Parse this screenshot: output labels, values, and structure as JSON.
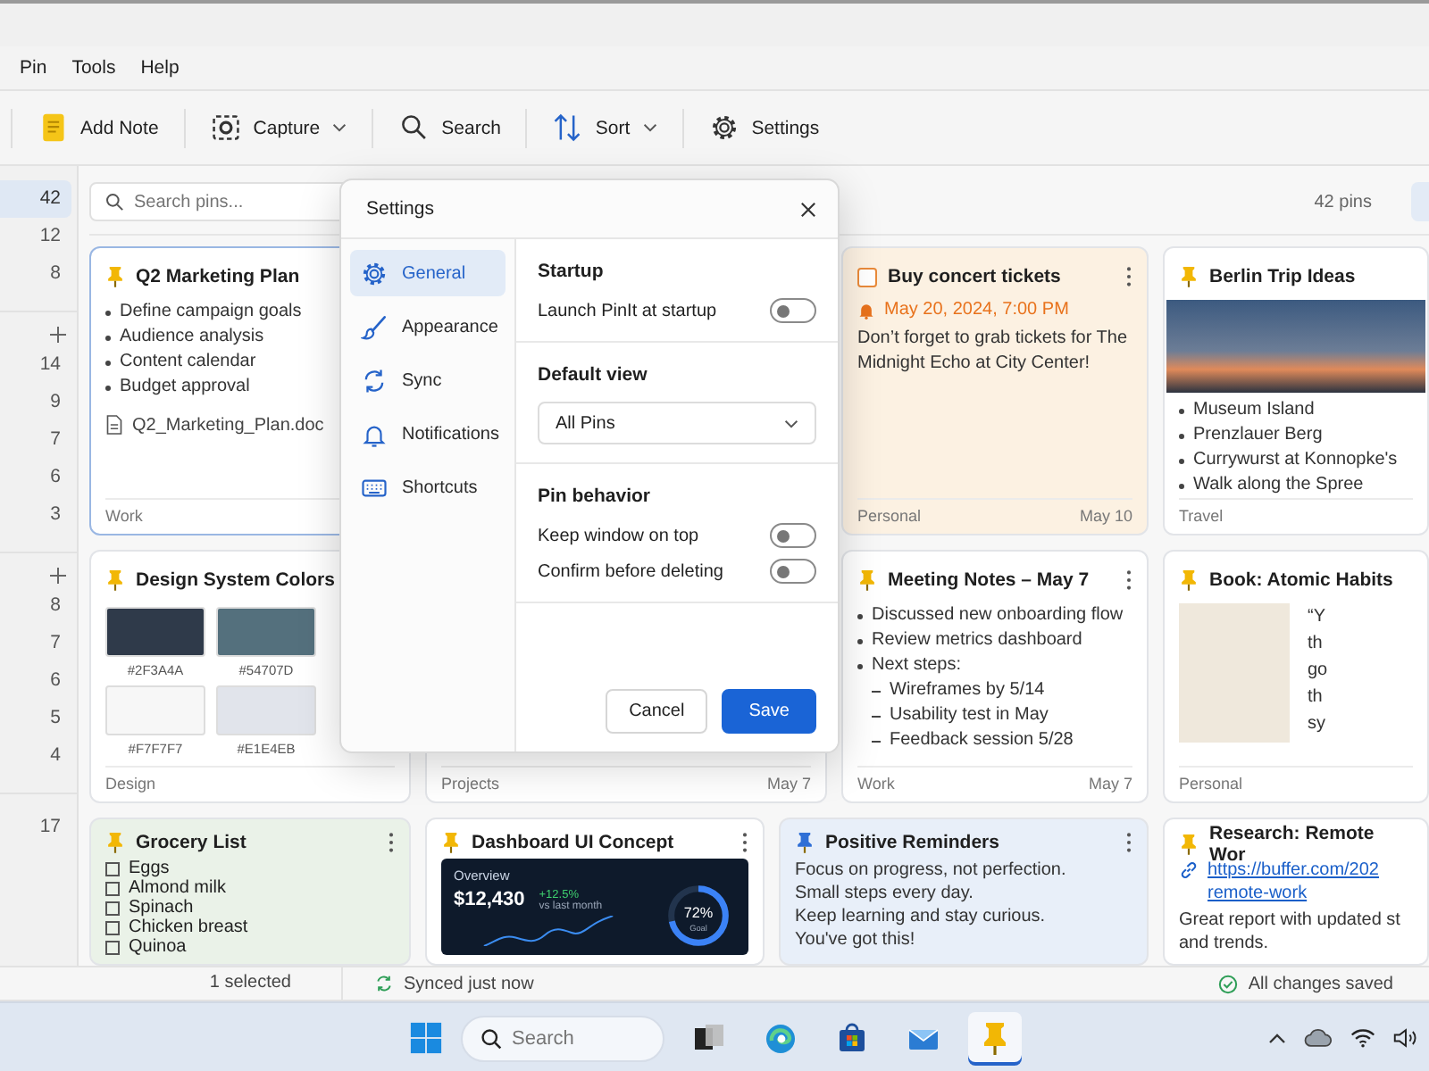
{
  "menu": [
    {
      "label": "Pin"
    },
    {
      "label": "Tools"
    },
    {
      "label": "Help"
    }
  ],
  "toolbar": [
    {
      "label": "Add Note",
      "dropdown": false
    },
    {
      "label": "Capture",
      "dropdown": true
    },
    {
      "label": "Search",
      "dropdown": false
    },
    {
      "label": "Sort",
      "dropdown": true
    },
    {
      "label": "Settings",
      "dropdown": false
    }
  ],
  "sidebar": {
    "groups": [
      {
        "addable": false,
        "items": [
          {
            "count": "42",
            "selected": true
          },
          {
            "count": "12",
            "selected": false
          },
          {
            "count": "8",
            "selected": false
          }
        ]
      },
      {
        "addable": true,
        "items": [
          {
            "count": "14",
            "selected": false
          },
          {
            "count": "9",
            "selected": false
          },
          {
            "count": "7",
            "selected": false
          },
          {
            "count": "6",
            "selected": false
          },
          {
            "count": "3",
            "selected": false
          }
        ]
      },
      {
        "addable": true,
        "items": [
          {
            "count": "8",
            "selected": false
          },
          {
            "count": "7",
            "selected": false
          },
          {
            "count": "6",
            "selected": false
          },
          {
            "count": "5",
            "selected": false
          },
          {
            "count": "4",
            "selected": false
          }
        ]
      },
      {
        "addable": false,
        "items": [
          {
            "count": "17",
            "selected": false
          }
        ]
      }
    ]
  },
  "main": {
    "search": {
      "placeholder": "Search pins..."
    },
    "count": "42 pins"
  },
  "rows": [
    [
      {
        "kind": "bullets",
        "title": "Q2 Marketing Plan",
        "selected": true,
        "pin": {
          "color": "#f2b705"
        },
        "bullets": [
          "Define campaign goals",
          "Audience analysis",
          "Content calendar",
          "Budget approval"
        ],
        "file": "Q2_Marketing_Plan.doc",
        "tag": "Work"
      },
      {
        "kind": "blank"
      },
      {
        "kind": "task",
        "title": "Buy concert tickets",
        "selected": false,
        "menu": true,
        "done": false,
        "color": "#fcf1e2",
        "reminder": "May 20, 2024, 7:00 PM",
        "text": "Don’t forget to grab tickets for The Midnight Echo at City Center!",
        "tag": "Personal",
        "date": "May 10"
      },
      {
        "kind": "photo_bullets",
        "title": "Berlin Trip Ideas",
        "selected": false,
        "menu": false,
        "pin": {
          "color": "#f2b705"
        },
        "bullets": [
          "Museum Island",
          "Prenzlauer Berg",
          "Currywurst at Konnopke's",
          "Walk along the Spree"
        ],
        "tag": "Travel"
      }
    ],
    [
      {
        "kind": "swatches",
        "title": "Design System Colors",
        "selected": false,
        "pin": {
          "color": "#f2b705"
        },
        "swatches": [
          {
            "color": "#2f3a4a",
            "label": "#2F3A4A"
          },
          {
            "color": "#54707d",
            "label": "#54707D"
          },
          {
            "color": "#f7f7f7",
            "label": "#F7F7F7"
          },
          {
            "color": "#e1e4eb",
            "label": "#E1E4EB"
          }
        ],
        "tag": "Design"
      },
      {
        "kind": "blank",
        "selected": false,
        "tag": "Projects",
        "date": "May 7"
      },
      {
        "kind": "outline",
        "title": "Meeting Notes – May 7",
        "selected": false,
        "menu": true,
        "pin": {
          "color": "#f2b705"
        },
        "bullets": [
          {
            "text": "Discussed new onboarding flow"
          },
          {
            "text": "Review metrics dashboard"
          },
          {
            "text": "Next steps:",
            "children": [
              {
                "text": "Wireframes by 5/14"
              },
              {
                "text": "Usability test in May"
              },
              {
                "text": "Feedback session 5/28"
              }
            ]
          }
        ],
        "tag": "Work",
        "date": "May 7"
      },
      {
        "kind": "book",
        "title": "Book: Atomic Habits",
        "selected": false,
        "menu": false,
        "pin": {
          "color": "#f2b705"
        },
        "quote": [
          "“Y",
          "th",
          "go",
          "th",
          "sy"
        ],
        "tag": "Personal"
      }
    ],
    [
      {
        "kind": "checklist",
        "title": "Grocery List",
        "selected": false,
        "menu": true,
        "color": "#eaf2e8",
        "pin": {
          "color": "#f2b705"
        },
        "items": [
          {
            "label": "Eggs",
            "checked": false
          },
          {
            "label": "Almond milk",
            "checked": false
          },
          {
            "label": "Spinach",
            "checked": false
          },
          {
            "label": "Chicken breast",
            "checked": false
          },
          {
            "label": "Quinoa",
            "checked": false
          }
        ]
      },
      {
        "kind": "dashboard",
        "title": "Dashboard UI Concept",
        "selected": false,
        "menu": true,
        "pin": {
          "color": "#f2b705"
        },
        "dashboard": {
          "heading": "Overview",
          "amount": "$12,430",
          "change": "+12.5%",
          "period": "vs last month",
          "gauge": {
            "level": 0.72,
            "reading": "72%",
            "caption": "Goal"
          }
        }
      },
      {
        "kind": "lines",
        "title": "Positive Reminders",
        "selected": false,
        "menu": true,
        "color": "#e8eff9",
        "pin": {
          "color": "#2f6fd6"
        },
        "lines": [
          "Focus on progress, not perfection.",
          "Small steps every day.",
          "Keep learning and stay curious.",
          "You've got this!"
        ]
      },
      {
        "kind": "link",
        "title": "Research: Remote Wor",
        "selected": false,
        "menu": false,
        "pin": {
          "color": "#f2b705"
        },
        "link": [
          "https://buffer.com/202",
          "remote-work"
        ],
        "text": [
          "Great report with updated st",
          "and trends."
        ]
      }
    ]
  ],
  "status": {
    "selection": "1 selected",
    "sync": "Synced just now",
    "saved": "All changes saved"
  },
  "taskbar": {
    "search": {
      "placeholder": "Search"
    },
    "apps": [
      {
        "active": false
      },
      {
        "active": false
      },
      {
        "active": false
      },
      {
        "active": false
      },
      {
        "active": true
      }
    ]
  },
  "modal": {
    "title": "Settings",
    "nav": [
      {
        "label": "General",
        "selected": true
      },
      {
        "label": "Appearance",
        "selected": false
      },
      {
        "label": "Sync",
        "selected": false
      },
      {
        "label": "Notifications",
        "selected": false
      },
      {
        "label": "Shortcuts",
        "selected": false
      }
    ],
    "sections": [
      {
        "heading": "Startup",
        "rows": [
          {
            "kind": "toggle",
            "label": "Launch PinIt at startup",
            "on": false
          }
        ]
      },
      {
        "heading": "Default view",
        "rows": [
          {
            "kind": "select",
            "value": "All Pins"
          }
        ]
      },
      {
        "heading": "Pin behavior",
        "rows": [
          {
            "kind": "toggle",
            "label": "Keep window on top",
            "on": false
          },
          {
            "kind": "toggle",
            "label": "Confirm before deleting",
            "on": false
          }
        ]
      }
    ],
    "buttons": [
      {
        "label": "Cancel",
        "primary": false
      },
      {
        "label": "Save",
        "primary": true
      }
    ]
  }
}
